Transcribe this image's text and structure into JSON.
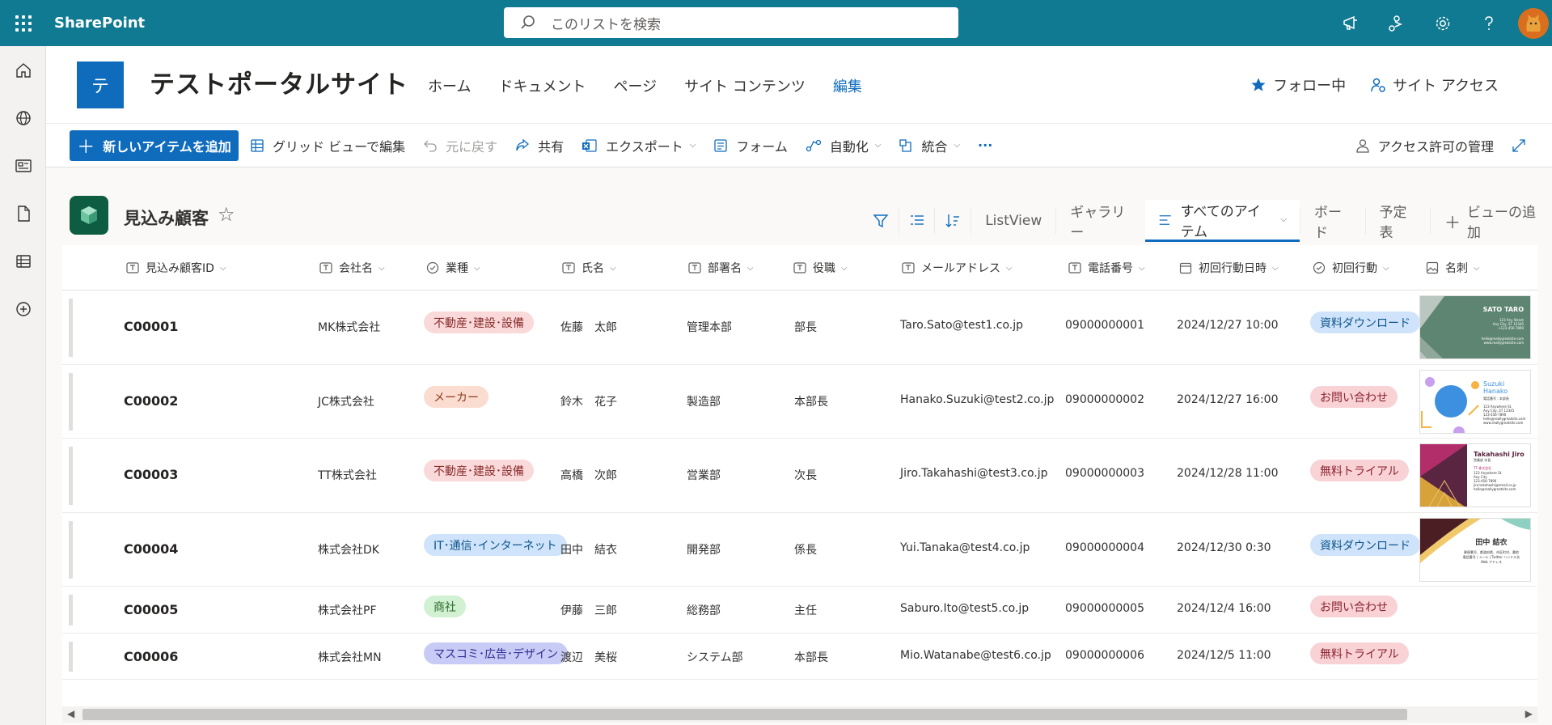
{
  "suite": {
    "brand": "SharePoint",
    "search_placeholder": "このリストを検索",
    "icons": [
      "announcement-icon",
      "share-settings-icon",
      "settings-gear-icon",
      "help-icon"
    ]
  },
  "site": {
    "logo_letter": "テ",
    "title": "テストポータルサイト",
    "nav": [
      "ホーム",
      "ドキュメント",
      "ページ",
      "サイト コンテンツ",
      "編集"
    ],
    "follow_label": "フォロー中",
    "site_access_label": "サイト アクセス"
  },
  "commands": {
    "new_item": "新しいアイテムを追加",
    "grid_edit": "グリッド ビューで編集",
    "undo": "元に戻す",
    "share": "共有",
    "export": "エクスポート",
    "forms": "フォーム",
    "automate": "自動化",
    "integrate": "統合",
    "more": "···",
    "manage_access": "アクセス許可の管理"
  },
  "list": {
    "title": "見込み顧客",
    "views": {
      "listview": "ListView",
      "gallery": "ギャラリー",
      "all_items": "すべてのアイテム",
      "board": "ボード",
      "calendar": "予定表",
      "add_view": "ビューの追加"
    },
    "columns": [
      "見込み顧客ID",
      "会社名",
      "業種",
      "氏名",
      "部署名",
      "役職",
      "メールアドレス",
      "電話番号",
      "初回行動日時",
      "初回行動",
      "名刺"
    ],
    "rows": [
      {
        "id": "C00001",
        "company": "MK株式会社",
        "industry": "不動産･建設･設備",
        "name": "佐藤　太郎",
        "dept": "管理本部",
        "title": "部長",
        "email": "Taro.Sato@test1.co.jp",
        "phone": "09000000001",
        "datetime": "2024/12/27 10:00",
        "action": "資料ダウンロード"
      },
      {
        "id": "C00002",
        "company": "JC株式会社",
        "industry": "メーカー",
        "name": "鈴木　花子",
        "dept": "製造部",
        "title": "本部長",
        "email": "Hanako.Suzuki@test2.co.jp",
        "phone": "09000000002",
        "datetime": "2024/12/27 16:00",
        "action": "お問い合わせ"
      },
      {
        "id": "C00003",
        "company": "TT株式会社",
        "industry": "不動産･建設･設備",
        "name": "高橋　次郎",
        "dept": "営業部",
        "title": "次長",
        "email": "Jiro.Takahashi@test3.co.jp",
        "phone": "09000000003",
        "datetime": "2024/12/28 11:00",
        "action": "無料トライアル"
      },
      {
        "id": "C00004",
        "company": "株式会社DK",
        "industry": "IT･通信･インターネット",
        "name": "田中　結衣",
        "dept": "開発部",
        "title": "係長",
        "email": "Yui.Tanaka@test4.co.jp",
        "phone": "09000000004",
        "datetime": "2024/12/30 0:30",
        "action": "資料ダウンロード"
      },
      {
        "id": "C00005",
        "company": "株式会社PF",
        "industry": "商社",
        "name": "伊藤　三郎",
        "dept": "総務部",
        "title": "主任",
        "email": "Saburo.Ito@test5.co.jp",
        "phone": "09000000005",
        "datetime": "2024/12/4 16:00",
        "action": "お問い合わせ"
      },
      {
        "id": "C00006",
        "company": "株式会社MN",
        "industry": "マスコミ･広告･デザイン",
        "name": "渡辺　美桜",
        "dept": "システム部",
        "title": "本部長",
        "email": "Mio.Watanabe@test6.co.jp",
        "phone": "09000000006",
        "datetime": "2024/12/5 11:00",
        "action": "無料トライアル"
      }
    ],
    "cards": [
      {
        "name": "SATO TARO",
        "lines": [
          "123 Any Street",
          "Any City, ST 12345",
          "+123-456-7890"
        ],
        "email": "hello@reallygreatsite.com",
        "site": "www.reallygreatsite.com"
      },
      {
        "name": "Suzuki Hanako",
        "lines": [
          "電話番号 : 本部長",
          "123 Anywhere St.",
          "Any City, ST 12345",
          "123-456-7890"
        ],
        "email": "hello@reallygreatsite.com",
        "site": "www.reallygreatsite.com"
      },
      {
        "name": "Takahashi Jiro",
        "lines": [
          "営業部 次長",
          "TT 株式会社",
          "123 Anywhere St.",
          "Any City",
          "123-456-7890"
        ],
        "email": "jiro.takahashi@email.co.jp",
        "site": "hello@reallygreatsite.com"
      },
      {
        "name": "田中 結衣",
        "lines": [
          "郵便番号、都道府県、市区町村、番地",
          "電話番号 | メール | Twitter ハンドル名",
          "Web アドレス"
        ]
      }
    ]
  },
  "colors": {
    "suitebar": "#0f7a91",
    "accent": "#0f6cbd",
    "list_icon": "#0e5c41",
    "industry_pills": {
      "不動産･建設･設備": {
        "bg": "#f9d9d9",
        "fg": "#8a2d2d"
      },
      "メーカー": {
        "bg": "#fbdcd0",
        "fg": "#8f3b1d"
      },
      "IT･通信･インターネット": {
        "bg": "#cfe4fa",
        "fg": "#0f548c"
      },
      "商社": {
        "bg": "#d2f0d2",
        "fg": "#2b6b2b"
      },
      "マスコミ･広告･デザイン": {
        "bg": "#c9cbf7",
        "fg": "#2d2f8f"
      }
    },
    "action_pills": {
      "資料ダウンロード": {
        "bg": "#cfe4fa",
        "fg": "#0f548c"
      },
      "お問い合わせ": {
        "bg": "#f9d2d6",
        "fg": "#8a2430"
      },
      "無料トライアル": {
        "bg": "#f9d2d6",
        "fg": "#8a2430"
      }
    }
  }
}
